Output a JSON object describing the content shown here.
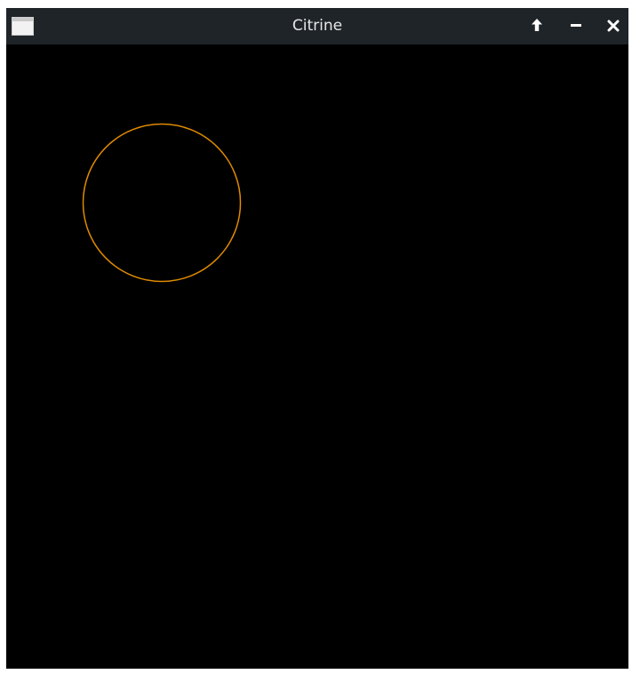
{
  "window": {
    "title": "Citrine",
    "icons": {
      "app": "window-icon",
      "up": "arrow-up-icon",
      "minimize": "minimize-icon",
      "close": "close-icon"
    }
  },
  "canvas": {
    "background": "#000000",
    "shape": {
      "type": "circle",
      "stroke_color": "#e08a00"
    }
  }
}
